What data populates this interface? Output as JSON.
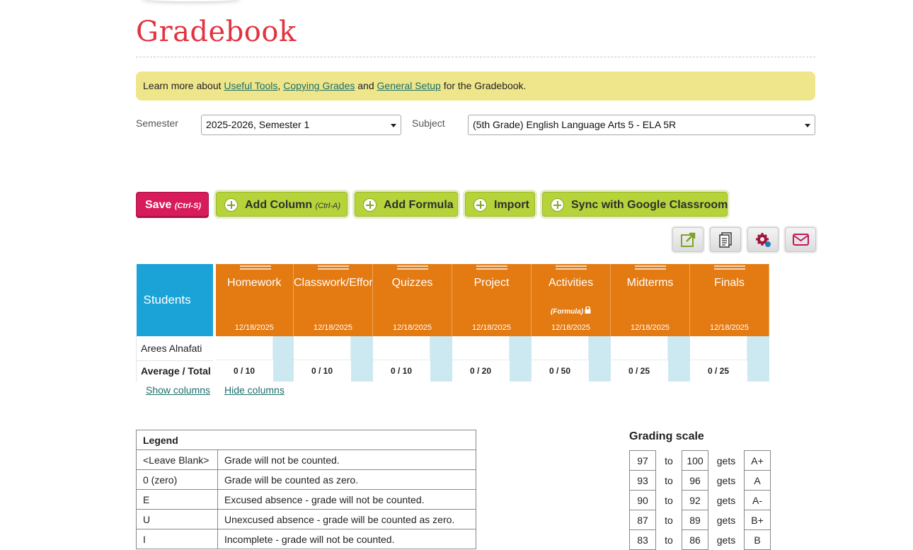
{
  "page": {
    "title": "Gradebook"
  },
  "info_bar": {
    "text_before": "Learn more about ",
    "link_useful_tools": "Useful Tools",
    "sep1": ", ",
    "link_copying_grades": "Copying Grades",
    "sep2": " and ",
    "link_general_setup": "General Setup",
    "text_after": " for the Gradebook."
  },
  "filters": {
    "semester_label": "Semester",
    "semester_value": "2025-2026, Semester 1",
    "subject_label": "Subject",
    "subject_value": "(5th Grade) English Language Arts 5 - ELA 5R"
  },
  "toolbar": {
    "save_label": "Save",
    "save_shortcut": "(Ctrl-S)",
    "add_column_label": "Add Column",
    "add_column_shortcut": "(Ctrl-A)",
    "add_formula_label": "Add Formula",
    "import_label": "Import",
    "sync_label": "Sync with Google Classroom"
  },
  "icon_toolbar": [
    "external-link-icon",
    "document-icon",
    "settings-icon",
    "email-icon"
  ],
  "gradebook": {
    "students_header": "Students",
    "columns": [
      {
        "name": "Homework",
        "date": "12/18/2025",
        "formula": "",
        "average": "0 / 10"
      },
      {
        "name": "Classwork/Effort",
        "date": "12/18/2025",
        "formula": "",
        "average": "0 / 10"
      },
      {
        "name": "Quizzes",
        "date": "12/18/2025",
        "formula": "",
        "average": "0 / 10"
      },
      {
        "name": "Project",
        "date": "12/18/2025",
        "formula": "",
        "average": "0 / 20"
      },
      {
        "name": "Activities",
        "date": "12/18/2025",
        "formula": "(Formula)",
        "average": "0 / 50"
      },
      {
        "name": "Midterms",
        "date": "12/18/2025",
        "formula": "",
        "average": "0 / 25"
      },
      {
        "name": "Finals",
        "date": "12/18/2025",
        "formula": "",
        "average": "0 / 25"
      }
    ],
    "students": [
      "Arees Alnafati"
    ],
    "average_label": "Average / Total",
    "colors": {
      "students_header": "#1ba3d8",
      "column_header": "#e37a12",
      "cell_side": "#cce9f2"
    }
  },
  "column_links": {
    "show": "Show columns",
    "hide": "Hide columns"
  },
  "legend": {
    "title": "Legend",
    "rows": [
      {
        "key": "<Leave Blank>",
        "desc": "Grade will not be counted."
      },
      {
        "key": "0 (zero)",
        "desc": "Grade will be counted as zero."
      },
      {
        "key": "E",
        "desc": "Excused absence - grade will not be counted."
      },
      {
        "key": "U",
        "desc": "Unexcused absence - grade will be counted as zero."
      },
      {
        "key": "I",
        "desc": "Incomplete - grade will not be counted."
      }
    ]
  },
  "grading_scale": {
    "title": "Grading scale",
    "to_word": "to",
    "gets_word": "gets",
    "rows": [
      {
        "min": "97",
        "max": "100",
        "grade": "A+"
      },
      {
        "min": "93",
        "max": "96",
        "grade": "A"
      },
      {
        "min": "90",
        "max": "92",
        "grade": "A-"
      },
      {
        "min": "87",
        "max": "89",
        "grade": "B+"
      },
      {
        "min": "83",
        "max": "86",
        "grade": "B"
      }
    ]
  }
}
